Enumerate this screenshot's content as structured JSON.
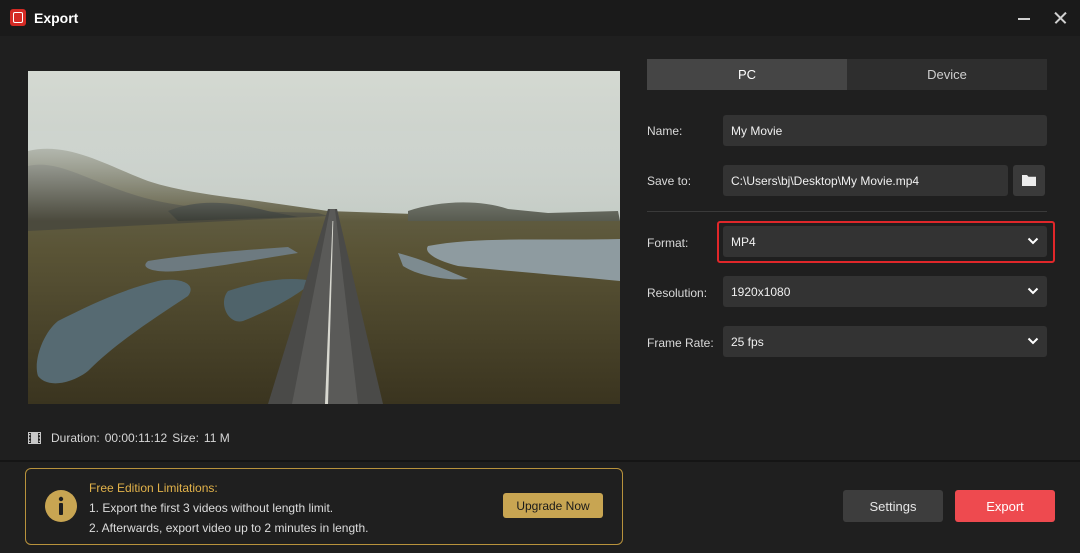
{
  "window": {
    "title": "Export"
  },
  "preview": {
    "duration_label": "Duration:",
    "duration": "00:00:11:12",
    "size_label": "Size:",
    "size": "11 M"
  },
  "tabs": [
    {
      "label": "PC",
      "selected": true
    },
    {
      "label": "Device",
      "selected": false
    }
  ],
  "form": {
    "name": {
      "label": "Name:",
      "value": "My Movie"
    },
    "save_to": {
      "label": "Save to:",
      "value": "C:\\Users\\bj\\Desktop\\My Movie.mp4"
    },
    "format": {
      "label": "Format:",
      "value": "MP4",
      "highlighted": true
    },
    "resolution": {
      "label": "Resolution:",
      "value": "1920x1080"
    },
    "frame_rate": {
      "label": "Frame Rate:",
      "value": "25 fps"
    }
  },
  "limitations": {
    "title": "Free Edition Limitations:",
    "line1": "1. Export the first 3 videos without length limit.",
    "line2": "2. Afterwards, export video up to 2 minutes in length.",
    "upgrade_label": "Upgrade Now"
  },
  "actions": {
    "settings_label": "Settings",
    "export_label": "Export"
  },
  "colors": {
    "accent_red": "#ee4a4f",
    "highlight_red": "#e0272a",
    "notice_gold": "#c8a552",
    "background": "#1f1f1f"
  },
  "icons": [
    "app-logo-icon",
    "minimize-icon",
    "close-icon",
    "film-icon",
    "folder-icon",
    "chevron-down-icon",
    "info-icon"
  ]
}
